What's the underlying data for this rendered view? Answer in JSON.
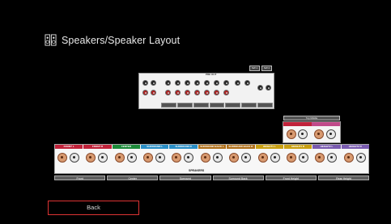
{
  "header": {
    "title": "Speakers/Speaker Layout",
    "icon": "speaker-layout-icon"
  },
  "preout": {
    "label": "PRE OUT",
    "sub_labels": [
      "SW 1",
      "SW 2"
    ],
    "bar_labels": [
      "Front",
      "Surround",
      "Surround Back",
      "Height 1",
      "Height 2",
      "Center",
      "SW 1"
    ]
  },
  "height_panel": {
    "label": "Top Middle"
  },
  "speaker_panel": {
    "label": "SPEAKERS",
    "channel_strips": [
      {
        "label": "FRONT L",
        "color": "#c0223a"
      },
      {
        "label": "FRONT R",
        "color": "#c0223a"
      },
      {
        "label": "CENTER",
        "color": "#1d8a3a"
      },
      {
        "label": "SURROUND L",
        "color": "#2a8fc7"
      },
      {
        "label": "SURROUND R",
        "color": "#2a8fc7"
      },
      {
        "label": "SURROUND BACK L",
        "color": "#b0701a"
      },
      {
        "label": "SURROUND BACK R",
        "color": "#b0701a"
      },
      {
        "label": "HEIGHT1 L",
        "color": "#c9a012"
      },
      {
        "label": "HEIGHT1 R",
        "color": "#c9a012"
      },
      {
        "label": "HEIGHT2 L",
        "color": "#7a5bb0"
      },
      {
        "label": "HEIGHT2 R",
        "color": "#7a5bb0"
      }
    ],
    "categories": [
      "Front",
      "Center",
      "Surround",
      "Surround Back",
      "Front Height",
      "Rear Height"
    ]
  },
  "footer": {
    "back_label": "Back"
  }
}
